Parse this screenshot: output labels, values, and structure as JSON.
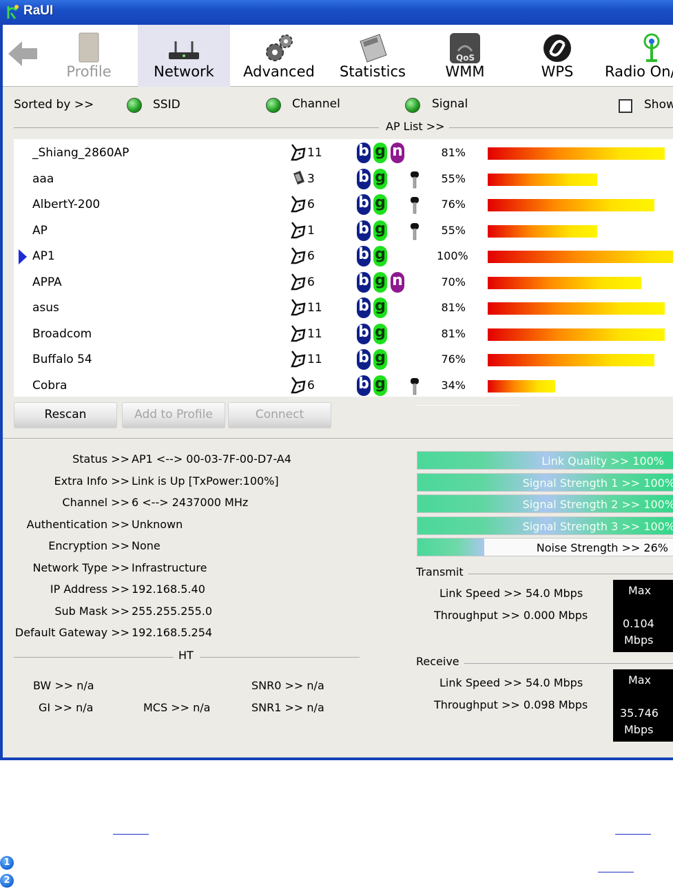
{
  "window": {
    "title": "RaUI"
  },
  "toolbar": {
    "items": [
      {
        "label": "Profile",
        "icon": "profile-icon"
      },
      {
        "label": "Network",
        "icon": "network-icon"
      },
      {
        "label": "Advanced",
        "icon": "gears-icon"
      },
      {
        "label": "Statistics",
        "icon": "calculator-icon"
      },
      {
        "label": "WMM",
        "icon": "qos-icon"
      },
      {
        "label": "WPS",
        "icon": "wps-icon"
      },
      {
        "label": "Radio On/",
        "icon": "antenna-icon"
      }
    ]
  },
  "sort": {
    "label": "Sorted by >>",
    "options": [
      "SSID",
      "Channel",
      "Signal"
    ],
    "show_label": "Show"
  },
  "ap_list": {
    "header": "AP List >>",
    "rows": [
      {
        "ssid": "_Shiang_2860AP",
        "channel": "11",
        "modes": [
          "b",
          "g",
          "n"
        ],
        "secured": false,
        "signal": "81%",
        "signal_value": 81
      },
      {
        "ssid": "aaa",
        "channel": "3",
        "modes": [
          "b",
          "g"
        ],
        "secured": true,
        "signal": "55%",
        "signal_value": 55
      },
      {
        "ssid": "AlbertY-200",
        "channel": "6",
        "modes": [
          "b",
          "g"
        ],
        "secured": true,
        "signal": "76%",
        "signal_value": 76
      },
      {
        "ssid": "AP",
        "channel": "1",
        "modes": [
          "b",
          "g"
        ],
        "secured": true,
        "signal": "55%",
        "signal_value": 55
      },
      {
        "ssid": "AP1",
        "channel": "6",
        "modes": [
          "b",
          "g"
        ],
        "secured": false,
        "signal": "100%",
        "signal_value": 100,
        "selected": true
      },
      {
        "ssid": "APPA",
        "channel": "6",
        "modes": [
          "b",
          "g",
          "n"
        ],
        "secured": false,
        "signal": "70%",
        "signal_value": 70
      },
      {
        "ssid": "asus",
        "channel": "11",
        "modes": [
          "b",
          "g"
        ],
        "secured": false,
        "signal": "81%",
        "signal_value": 81
      },
      {
        "ssid": "Broadcom",
        "channel": "11",
        "modes": [
          "b",
          "g"
        ],
        "secured": false,
        "signal": "81%",
        "signal_value": 81
      },
      {
        "ssid": "Buffalo 54",
        "channel": "11",
        "modes": [
          "b",
          "g"
        ],
        "secured": false,
        "signal": "76%",
        "signal_value": 76
      },
      {
        "ssid": "Cobra",
        "channel": "6",
        "modes": [
          "b",
          "g"
        ],
        "secured": true,
        "signal": "34%",
        "signal_value": 34
      }
    ]
  },
  "buttons": {
    "rescan": "Rescan",
    "add_to_profile": "Add to Profile",
    "connect": "Connect"
  },
  "info": {
    "status_label": "Status >>",
    "status": "AP1 <--> 00-03-7F-00-D7-A4",
    "extra_label": "Extra Info >>",
    "extra": "Link is Up [TxPower:100%]",
    "channel_label": "Channel >>",
    "channel": "6 <--> 2437000 MHz",
    "auth_label": "Authentication >>",
    "auth": "Unknown",
    "enc_label": "Encryption >>",
    "enc": "None",
    "nettype_label": "Network Type >>",
    "nettype": "Infrastructure",
    "ip_label": "IP Address >>",
    "ip": "192.168.5.40",
    "mask_label": "Sub Mask >>",
    "mask": "255.255.255.0",
    "gw_label": "Default Gateway >>",
    "gw": "192.168.5.254",
    "ht_header": "HT",
    "bw": "BW >> n/a",
    "gi": "GI >> n/a",
    "mcs": "MCS >> n/a",
    "snr0": "SNR0 >> n/a",
    "snr1": "SNR1 >> n/a"
  },
  "quality": {
    "link_quality": {
      "text": "Link Quality >> 100%",
      "value": 100
    },
    "signal1": {
      "text": "Signal Strength 1 >> 100%",
      "value": 100
    },
    "signal2": {
      "text": "Signal Strength 2 >> 100%",
      "value": 100
    },
    "signal3": {
      "text": "Signal Strength 3 >> 100%",
      "value": 100
    },
    "noise": {
      "text": "Noise Strength >> 26%",
      "value": 26
    }
  },
  "transmit": {
    "header": "Transmit",
    "link_speed": "Link Speed >> 54.0 Mbps",
    "throughput": "Throughput >> 0.000 Mbps",
    "max_label": "Max",
    "max_value": "0.104",
    "max_unit": "Mbps"
  },
  "receive": {
    "header": "Receive",
    "link_speed": "Link Speed >> 54.0 Mbps",
    "throughput": "Throughput >> 0.098 Mbps",
    "max_label": "Max",
    "max_value": "35.746",
    "max_unit": "Mbps"
  },
  "footnotes": [
    "1",
    "2"
  ],
  "colors": {
    "titlebar": "#1a4fc7",
    "signal_bar_start": "#e30000",
    "signal_bar_end": "#fff500",
    "quality_fill": "#4bd89a"
  }
}
